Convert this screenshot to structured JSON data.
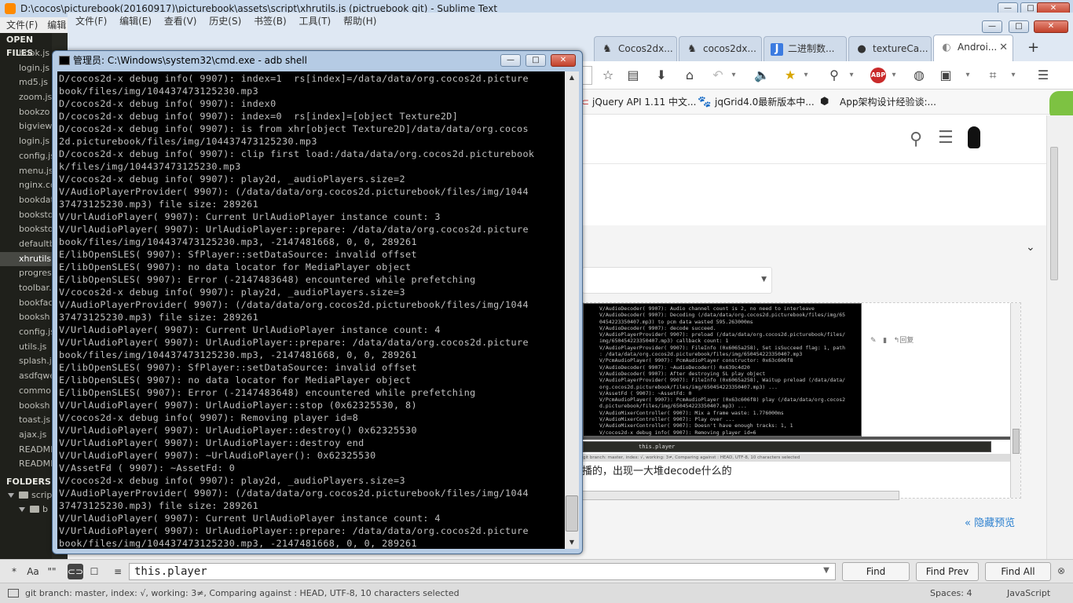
{
  "sublime": {
    "title": "D:\\cocos\\picturebook(20160917)\\picturebook\\assets\\script\\xhrutils.js (pictruebook git) - Sublime Text",
    "menu": [
      "文件(F)",
      "编辑"
    ],
    "sidebar": {
      "open_files_label": "OPEN FILES",
      "files": [
        "book.js",
        "login.js",
        "md5.js",
        "zoom.js",
        "bookzo",
        "bigview",
        "login.js",
        "config.js",
        "menu.js",
        "nginx.co",
        "bookdat",
        "booksto",
        "booksto",
        "defaultb",
        "xhrutils.",
        "progres",
        "toolbar.",
        "bookfac",
        "booksh",
        "config.js",
        "utils.js",
        "splash.js",
        "asdfqwe",
        "commo",
        "booksh",
        "toast.js",
        "ajax.js",
        "README",
        "README"
      ],
      "selected_index": 14,
      "folders_label": "FOLDERS",
      "folder_items": [
        "scrip",
        "b"
      ]
    },
    "find": {
      "options": [
        "*",
        "Aa",
        "\"\"",
        "⊂⊃",
        "☐",
        "≡"
      ],
      "query": "this.player",
      "find_label": "Find",
      "find_prev_label": "Find Prev",
      "find_all_label": "Find All"
    },
    "status": {
      "left": "git branch: master, index: √, working: 3≠, Comparing against : HEAD, UTF-8, 10 characters selected",
      "spaces": "Spaces: 4",
      "syntax": "JavaScript"
    }
  },
  "browser": {
    "menu": [
      "文件(F)",
      "编辑(E)",
      "查看(V)",
      "历史(S)",
      "书签(B)",
      "工具(T)",
      "帮助(H)"
    ],
    "tabs": [
      {
        "label": "Cocos2dx...",
        "icon": "cocos-icon"
      },
      {
        "label": "cocos2dx...",
        "icon": "cocos-icon"
      },
      {
        "label": "二进制数...",
        "icon": "j-icon"
      },
      {
        "label": "textureCa...",
        "icon": "github-icon"
      },
      {
        "label": "Androi...",
        "icon": "globe-icon"
      }
    ],
    "bookmarks": [
      "jQuery API 1.11 中文...",
      "jqGrid4.0最新版本中...",
      "App架构设计经验谈:..."
    ],
    "page_text": "播的，出现一大堆decode什么的",
    "hide_preview": "« 隐藏预览",
    "accent_color": "#2c80cf"
  },
  "cmd": {
    "title": "管理员: C:\\Windows\\system32\\cmd.exe - adb  shell",
    "lines": [
      "D/cocos2d-x debug info( 9907): index=1  rs[index]=/data/data/org.cocos2d.picture",
      "book/files/img/104437473125230.mp3",
      "D/cocos2d-x debug info( 9907): index0",
      "D/cocos2d-x debug info( 9907): index=0  rs[index]=[object Texture2D]",
      "D/cocos2d-x debug info( 9907): is from xhr[object Texture2D]/data/data/org.cocos",
      "2d.picturebook/files/img/104437473125230.mp3",
      "D/cocos2d-x debug info( 9907): clip first load:/data/data/org.cocos2d.picturebook",
      "k/files/img/104437473125230.mp3",
      "V/cocos2d-x debug info( 9907): play2d, _audioPlayers.size=2",
      "V/AudioPlayerProvider( 9907): (/data/data/org.cocos2d.picturebook/files/img/1044",
      "37473125230.mp3) file size: 289261",
      "V/UrlAudioPlayer( 9907): Current UrlAudioPlayer instance count: 3",
      "V/UrlAudioPlayer( 9907): UrlAudioPlayer::prepare: /data/data/org.cocos2d.picture",
      "book/files/img/104437473125230.mp3, -2147481668, 0, 0, 289261",
      "E/libOpenSLES( 9907): SfPlayer::setDataSource: invalid offset",
      "E/libOpenSLES( 9907): no data locator for MediaPlayer object",
      "E/libOpenSLES( 9907): Error (-2147483648) encountered while prefetching",
      "V/cocos2d-x debug info( 9907): play2d, _audioPlayers.size=3",
      "V/AudioPlayerProvider( 9907): (/data/data/org.cocos2d.picturebook/files/img/1044",
      "37473125230.mp3) file size: 289261",
      "V/UrlAudioPlayer( 9907): Current UrlAudioPlayer instance count: 4",
      "V/UrlAudioPlayer( 9907): UrlAudioPlayer::prepare: /data/data/org.cocos2d.picture",
      "book/files/img/104437473125230.mp3, -2147481668, 0, 0, 289261",
      "E/libOpenSLES( 9907): SfPlayer::setDataSource: invalid offset",
      "E/libOpenSLES( 9907): no data locator for MediaPlayer object",
      "E/libOpenSLES( 9907): Error (-2147483648) encountered while prefetching",
      "V/UrlAudioPlayer( 9907): UrlAudioPlayer::stop (0x62325530, 8)",
      "V/cocos2d-x debug info( 9907): Removing player id=8",
      "V/UrlAudioPlayer( 9907): UrlAudioPlayer::destroy() 0x62325530",
      "V/UrlAudioPlayer( 9907): UrlAudioPlayer::destroy end",
      "V/UrlAudioPlayer( 9907): ~UrlAudioPlayer(): 0x62325530",
      "V/AssetFd ( 9907): ~AssetFd: 0",
      "V/cocos2d-x debug info( 9907): play2d, _audioPlayers.size=3",
      "V/AudioPlayerProvider( 9907): (/data/data/org.cocos2d.picturebook/files/img/1044",
      "37473125230.mp3) file size: 289261",
      "V/UrlAudioPlayer( 9907): Current UrlAudioPlayer instance count: 4",
      "V/UrlAudioPlayer( 9907): UrlAudioPlayer::prepare: /data/data/org.cocos2d.picture",
      "book/files/img/104437473125230.mp3, -2147481668, 0, 0, 289261"
    ]
  },
  "preview_shot": {
    "lines": [
      "V/AudioDecoder( 9907): Audio channel count is 2, no need to interleave",
      "V/AudioDecoder( 9907): Decoding (/data/data/org.cocos2d.picturebook/files/img/65",
      "0454223350407.mp3) to pcm data wasted 595.263000ms",
      "V/AudioDecoder( 9907): decode succeed.",
      "V/AudioPlayerProvider( 9907): preload (/data/data/org.cocos2d.picturebook/files/",
      "img/650454223350407.mp3) callback count: 1",
      "V/AudioPlayerProvider( 9907): FileInfo (0x6065a258), Set isSucceed flag: 1, path",
      ": /data/data/org.cocos2d.picturebook/files/img/650454223350407.mp3",
      "V/PcmAudioPlayer( 9907): PcmAudioPlayer constructor: 0x63c606f8",
      "V/AudioDecoder( 9907): ~AudioDecoder() 0x639c4d20",
      "V/AudioDecoder( 9907): After destroying SL play object",
      "V/AudioPlayerProvider( 9907): FileInfo (0x6065a258), Waitup preload (/data/data/",
      "org.cocos2d.picturebook/files/img/650454223350407.mp3) ...",
      "V/AssetFd ( 9907): ~AssetFd: 0",
      "V/PcmAudioPlayer( 9907): PcmAudioPlayer (0x63c606f8) play (/data/data/org.cocos2",
      "d.picturebook/files/img/650454223350407.mp3) ...",
      "V/AudioMixerController( 9907): Mix a frame waste: 1.776000ms",
      "V/AudioMixerController( 9907): Play over ...",
      "V/AudioMixerController( 9907): Doesn't have enough tracks: 1, 1",
      "V/cocos2d-x debug info( 9907): Removing player id=6",
      "V/PcmAudioPlayer( 9907): In the destructor of PcmAudioPlayer (0x63c606f8)"
    ],
    "find_query": "this.player",
    "status": "git branch: master, index: √, working: 3≠, Comparing against : HEAD, UTF-8, 10 characters selected",
    "reply": "回复"
  }
}
